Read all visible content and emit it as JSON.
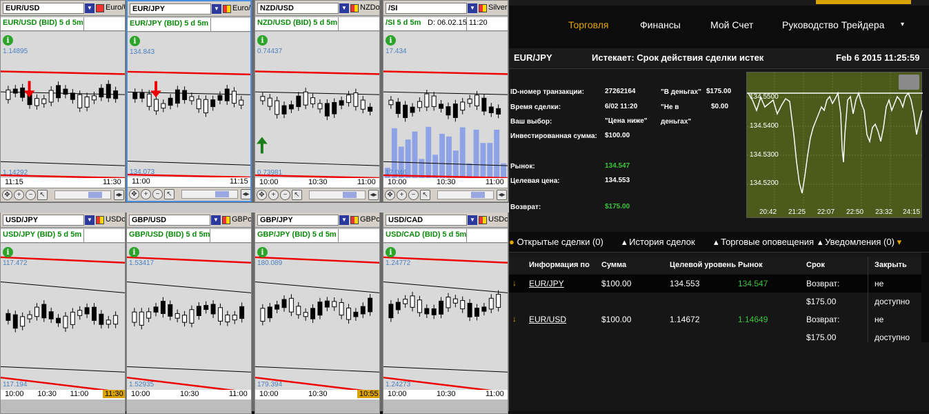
{
  "panels": [
    {
      "symbol": "EUR/USD",
      "currency": "Euro/US",
      "title": "EUR/USD (BID) 5 d 5m",
      "max": "1.14895",
      "min": "1.14292",
      "x": [
        "11:15",
        "11:30"
      ],
      "arrow": "down"
    },
    {
      "symbol": "EUR/JPY",
      "currency": "Euro/Jap",
      "title": "EUR/JPY (BID) 5 d 5m",
      "max": "134.843",
      "min": "134.073",
      "x": [
        "11:00",
        "11:15"
      ],
      "arrow": "down",
      "selected": true
    },
    {
      "symbol": "NZD/USD",
      "currency": "NZDolla",
      "title": "NZD/USD (BID) 5 d 5m",
      "max": "0.74437",
      "min": "0.73981",
      "x": [
        "10:00",
        "10:30",
        "11:00"
      ],
      "arrow": "up"
    },
    {
      "symbol": "/SI",
      "currency": "Silver F",
      "title": "/SI 5 d 5m",
      "date": "D: 06.02.15 11:20",
      "max": "17.434",
      "min": "17.046",
      "x": [
        "10:00",
        "10:30",
        "11:00"
      ]
    },
    {
      "symbol": "USD/JPY",
      "currency": "USDolla",
      "title": "USD/JPY (BID) 5 d 5m",
      "max": "117.472",
      "min": "117.194",
      "x": [
        "10:00",
        "10:30",
        "11:00",
        "11:30"
      ],
      "hl": "11:30"
    },
    {
      "symbol": "GBP/USD",
      "currency": "GBPoun",
      "title": "GBP/USD (BID) 5 d 5m",
      "max": "1.53417",
      "min": "1.52935",
      "x": [
        "10:00",
        "10:30",
        "11:00"
      ]
    },
    {
      "symbol": "GBP/JPY",
      "currency": "GBPoun",
      "title": "GBP/JPY (BID) 5 d 5m",
      "max": "180.089",
      "min": "179.394",
      "x": [
        "10:00",
        "10:30",
        "10:55"
      ],
      "hl": "10:55"
    },
    {
      "symbol": "USD/CAD",
      "currency": "USDolla",
      "title": "USD/CAD (BID) 5 d 5m",
      "max": "1.24772",
      "min": "1.24273",
      "x": [
        "10:00",
        "10:30",
        "11:00"
      ]
    }
  ],
  "nav": [
    "Торговля",
    "Финансы",
    "Мой Счет",
    "Руководство Трейдера"
  ],
  "header": {
    "pair": "EUR/JPY",
    "expires": "Истекает:  Срок действия сделки истек",
    "time": "Feb 6 2015  11:25:59"
  },
  "details": {
    "txn_label": "ID-номер транзакции:",
    "txn": "27262164",
    "time_label": "Время сделки:",
    "time": "6/02 11:20",
    "choice_label": "Ваш выбор:",
    "choice": "\"Цена ниже\"",
    "inv_label": "Инвестированная сумма:",
    "inv": "$100.00",
    "in_money": "\"В деньгах\"",
    "in_money_val": "$175.00",
    "not_in": "\"Не в",
    "not_in2": "деньгах\"",
    "not_in_val": "$0.00",
    "market_label": "Рынок:",
    "market": "134.547",
    "target_label": "Целевая цена:",
    "target": "134.553",
    "return_label": "Возврат:",
    "return": "$175.00"
  },
  "mini": {
    "y": [
      "134.5500",
      "134.5400",
      "134.5300",
      "134.5200"
    ],
    "x": [
      "20:42",
      "21:25",
      "22:07",
      "22:50",
      "23:32",
      "24:15"
    ]
  },
  "tabs": [
    "Открытые сделки (0)",
    "История сделок",
    "Торговые оповещения",
    "Уведомления (0)"
  ],
  "columns": [
    "Информация по",
    "Сумма",
    "Целевой уровень",
    "Рынок",
    "Срок",
    "Закрыть"
  ],
  "rows": [
    {
      "pair": "EUR/JPY",
      "amount": "$100.00",
      "target": "134.553",
      "market": "134.547",
      "term1": "Возврат:",
      "term2": "$175.00",
      "close1": "не",
      "close2": "доступно"
    },
    {
      "pair": "EUR/USD",
      "amount": "$100.00",
      "target": "1.14672",
      "market": "1.14649",
      "term1": "Возврат:",
      "term2": "$175.00",
      "close1": "не",
      "close2": "доступно"
    }
  ]
}
